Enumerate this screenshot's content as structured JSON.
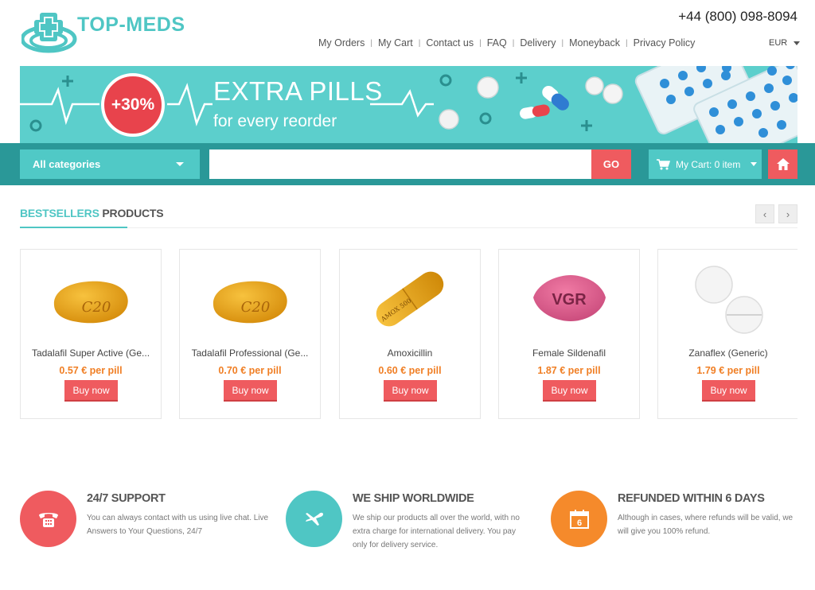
{
  "header": {
    "logo_text": "TOP-MEDS",
    "phone": "+44 (800) 098-8094",
    "nav": [
      "My Orders",
      "My Cart",
      "Contact us",
      "FAQ",
      "Delivery",
      "Moneyback",
      "Privacy Policy"
    ],
    "currency": "EUR"
  },
  "banner": {
    "badge": "+30%",
    "title": "EXTRA PILLS",
    "subtitle": "for every reorder"
  },
  "search": {
    "category": "All categories",
    "placeholder": "",
    "go_label": "GO",
    "cart_label": "My Cart: 0 item"
  },
  "bestsellers": {
    "title_accent": "BESTSELLERS",
    "title_rest": "PRODUCTS",
    "prev_icon": "‹",
    "next_icon": "›",
    "products": [
      {
        "name": "Tadalafil Super Active (Ge...",
        "price": "0.57 € per pill",
        "buy": "Buy now",
        "image": "yellow-oval-pill",
        "imprint": "C20"
      },
      {
        "name": "Tadalafil Professional (Ge...",
        "price": "0.70 € per pill",
        "buy": "Buy now",
        "image": "yellow-oval-pill",
        "imprint": "C20"
      },
      {
        "name": "Amoxicillin",
        "price": "0.60 € per pill",
        "buy": "Buy now",
        "image": "yellow-capsule",
        "imprint": "AMOX 500"
      },
      {
        "name": "Female Sildenafil",
        "price": "1.87 € per pill",
        "buy": "Buy now",
        "image": "pink-pill",
        "imprint": "VGR"
      },
      {
        "name": "Zanaflex (Generic)",
        "price": "1.79 € per pill",
        "buy": "Buy now",
        "image": "white-round-pills",
        "imprint": ""
      }
    ]
  },
  "features": [
    {
      "title": "24/7 SUPPORT",
      "text": "You can always contact with us using live chat. Live Answers to Your Questions, 24/7",
      "icon": "phone-icon",
      "color": "#ef5b5f"
    },
    {
      "title": "WE SHIP WORLDWIDE",
      "text": "We ship our products all over the world, with no extra charge for international delivery. You pay only for delivery service.",
      "icon": "airplane-icon",
      "color": "#4fc6c4"
    },
    {
      "title": "REFUNDED WITHIN 6 DAYS",
      "text": "Although in cases, where refunds will be valid, we will give you 100% refund.",
      "icon": "calendar-icon",
      "calendar_day": "6",
      "color": "#f58a2b"
    }
  ],
  "colors": {
    "teal": "#4fc6c4",
    "dark_teal": "#2a9898",
    "red": "#ef5b5f",
    "orange": "#f07f25"
  }
}
